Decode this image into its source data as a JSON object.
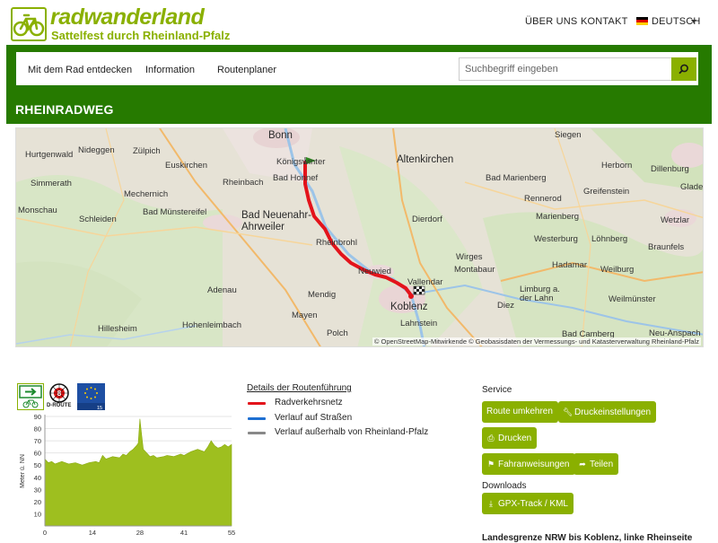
{
  "header": {
    "logo_title": "radwanderland",
    "logo_subtitle": "Sattelfest durch Rheinland-Pfalz",
    "nav": [
      "ÜBER UNS",
      "KONTAKT"
    ],
    "language": "DEUTSCH",
    "language_flag_colors": [
      "#000000",
      "#dd0000",
      "#ffce00"
    ]
  },
  "mainnav": {
    "items": [
      "Mit dem Rad entdecken",
      "Information",
      "Routenplaner"
    ],
    "search_placeholder": "Suchbegriff eingeben",
    "search_icon": "search-icon"
  },
  "page": {
    "title": "RHEINRADWEG"
  },
  "map": {
    "places": [
      {
        "name": "Bonn",
        "big": true
      },
      {
        "name": "Hurtgenwald"
      },
      {
        "name": "Zülpich"
      },
      {
        "name": "Nideggen"
      },
      {
        "name": "Euskirchen"
      },
      {
        "name": "Simmerath"
      },
      {
        "name": "Mechernich"
      },
      {
        "name": "Rheinbach"
      },
      {
        "name": "Monschau"
      },
      {
        "name": "Schleiden"
      },
      {
        "name": "Bad Münstereifel"
      },
      {
        "name": "Königswinter"
      },
      {
        "name": "Bad Honnef"
      },
      {
        "name": "Bad Neuenahr-\nAhrweiler",
        "big": true
      },
      {
        "name": "Altenkirchen",
        "big": true
      },
      {
        "name": "Bad Marienberg"
      },
      {
        "name": "Rennerod"
      },
      {
        "name": "Greifenstein"
      },
      {
        "name": "Herborn"
      },
      {
        "name": "Siegen"
      },
      {
        "name": "Dillenburg"
      },
      {
        "name": "Wetzlar"
      },
      {
        "name": "Marienberg"
      },
      {
        "name": "Dierdorf"
      },
      {
        "name": "Rheinbrohl"
      },
      {
        "name": "Neuwied"
      },
      {
        "name": "Vallendar"
      },
      {
        "name": "Koblenz",
        "big": true
      },
      {
        "name": "Lahnstein"
      },
      {
        "name": "Mendig"
      },
      {
        "name": "Mayen"
      },
      {
        "name": "Polch"
      },
      {
        "name": "Adenau"
      },
      {
        "name": "Hillesheim"
      },
      {
        "name": "Hohenleimbach"
      },
      {
        "name": "Wirges"
      },
      {
        "name": "Montabaur"
      },
      {
        "name": "Diez"
      },
      {
        "name": "Hadamar"
      },
      {
        "name": "Limburg a.\nder Lahn"
      },
      {
        "name": "Löhnberg"
      },
      {
        "name": "Weilburg"
      },
      {
        "name": "Braunfels"
      },
      {
        "name": "Bad Camberg"
      },
      {
        "name": "Neu-Anspach"
      },
      {
        "name": "Westerburg"
      },
      {
        "name": "Gladenbach"
      },
      {
        "name": "Weilmünster"
      }
    ],
    "attribution": "© OpenStreetMap-Mitwirkende © Geobasisdaten der Vermessungs- und Katasterverwaltung Rheinland-Pfalz"
  },
  "badges": {
    "dl_label": "D-ROUTE",
    "dl_number": "8",
    "euro_number": "15"
  },
  "elevation": {
    "ylabel": "Meter ü. NN",
    "yticks": [
      "10",
      "20",
      "30",
      "40",
      "50",
      "60",
      "70",
      "80",
      "90"
    ],
    "xticks": [
      "0",
      "14",
      "28",
      "41",
      "55"
    ],
    "xlim": [
      0,
      55
    ],
    "ylim": [
      0,
      90
    ],
    "fill_color": "#9ebf1f",
    "profile": [
      [
        0,
        55
      ],
      [
        1,
        52
      ],
      [
        2,
        53
      ],
      [
        3,
        51
      ],
      [
        5,
        53
      ],
      [
        7,
        51
      ],
      [
        9,
        52
      ],
      [
        11,
        50
      ],
      [
        13,
        52
      ],
      [
        15,
        53
      ],
      [
        16,
        52
      ],
      [
        17,
        58
      ],
      [
        18,
        55
      ],
      [
        20,
        57
      ],
      [
        22,
        56
      ],
      [
        23,
        59
      ],
      [
        24,
        58
      ],
      [
        25,
        61
      ],
      [
        26,
        63
      ],
      [
        27,
        66
      ],
      [
        27.5,
        68
      ],
      [
        28,
        88
      ],
      [
        28.5,
        75
      ],
      [
        29,
        63
      ],
      [
        30,
        60
      ],
      [
        31,
        57
      ],
      [
        32,
        58
      ],
      [
        33,
        56
      ],
      [
        35,
        57
      ],
      [
        36,
        58
      ],
      [
        38,
        57
      ],
      [
        40,
        59
      ],
      [
        41,
        58
      ],
      [
        43,
        61
      ],
      [
        45,
        63
      ],
      [
        47,
        61
      ],
      [
        48,
        65
      ],
      [
        49,
        70
      ],
      [
        50,
        66
      ],
      [
        51,
        64
      ],
      [
        52,
        65
      ],
      [
        53,
        67
      ],
      [
        54,
        65
      ],
      [
        55,
        67
      ]
    ]
  },
  "legend": {
    "title": "Details der Routenführung",
    "items": [
      {
        "label": "Radverkehrsnetz",
        "color": "#e3131b"
      },
      {
        "label": "Verlauf auf Straßen",
        "color": "#1e6fd2"
      },
      {
        "label": "Verlauf außerhalb von Rheinland-Pfalz",
        "color": "#888888"
      }
    ]
  },
  "service": {
    "heading": "Service",
    "buttons": [
      "Route umkehren",
      "Druckeinstellungen",
      "Drucken",
      "Fahranweisungen",
      "Teilen"
    ],
    "downloads_heading": "Downloads",
    "download_button": "GPX-Track / KML",
    "route_description": "Landesgrenze NRW bis Koblenz, linke Rheinseite"
  },
  "colors": {
    "brand_green": "#8ab000",
    "dark_green": "#267a00",
    "route_red": "#e3131b"
  }
}
